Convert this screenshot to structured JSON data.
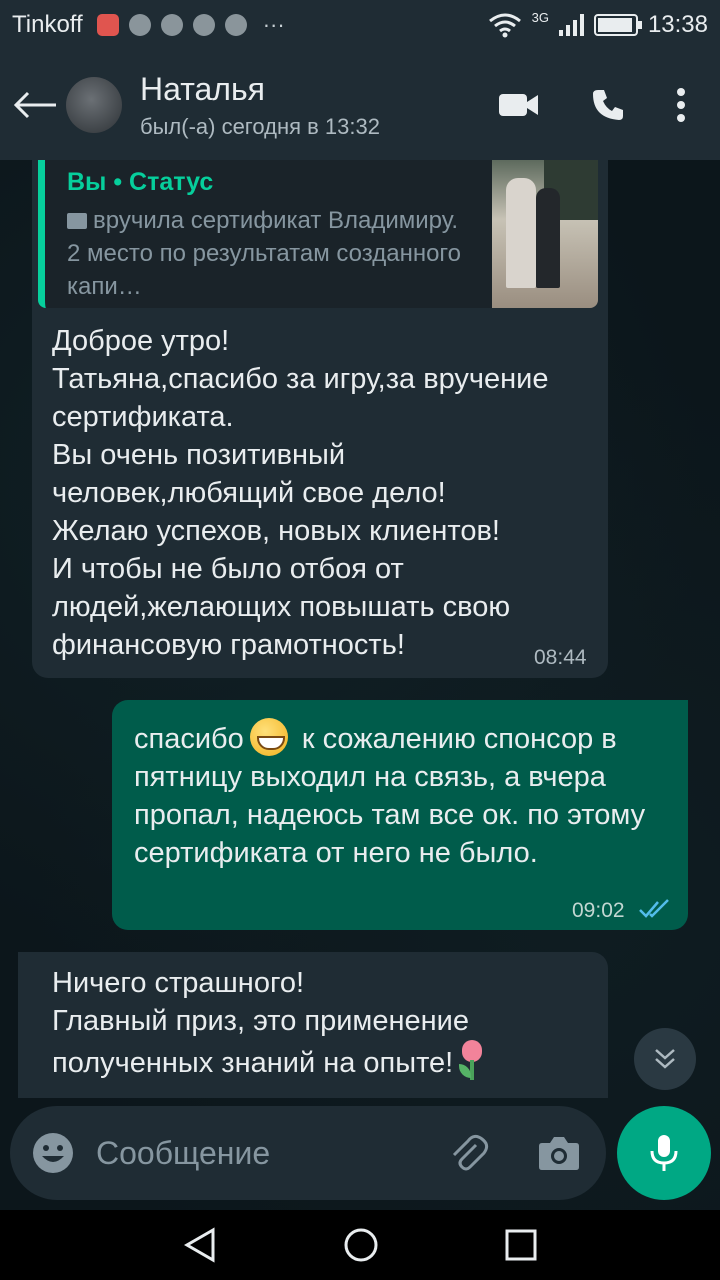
{
  "status_bar": {
    "carrier": "Tinkoff",
    "network": "3G",
    "time": "13:38",
    "battery_level": 0.95
  },
  "header": {
    "contact_name": "Наталья",
    "last_seen": "был(-а) сегодня в 13:32"
  },
  "messages": [
    {
      "direction": "incoming",
      "quote": {
        "author": "Вы • Статус",
        "text": "вручила сертификат Владимиру. 2 место по результатам созданного капи…"
      },
      "text": "Доброе утро!\nТатьяна,спасибо за игру,за вручение сертификата.\nВы очень позитивный человек,любящий свое дело!\nЖелаю успехов, новых клиентов!\nИ чтобы не было отбоя от людей,желающих повышать свою финансовую грамотность!",
      "time": "08:44"
    },
    {
      "direction": "outgoing",
      "text_before_emoji": "спасибо",
      "emoji": "grinning-face",
      "text_after_emoji": " к сожалению спонсор в пятницу выходил на связь, а вчера пропал, надеюсь там все ок. по этому сертификата от него не было.",
      "time": "09:02",
      "status": "read"
    },
    {
      "direction": "incoming",
      "text": "Ничего страшного!\nГлавный приз, это применение полученных знаний на опыте!",
      "emoji": "tulip"
    }
  ],
  "composer": {
    "placeholder": "Сообщение"
  },
  "colors": {
    "header_bg": "#1f2c34",
    "incoming_bubble": "#1f2c34",
    "outgoing_bubble": "#005c4b",
    "accent": "#00a884",
    "quote_accent": "#06cf9c",
    "read_ticks": "#53bdeb"
  }
}
